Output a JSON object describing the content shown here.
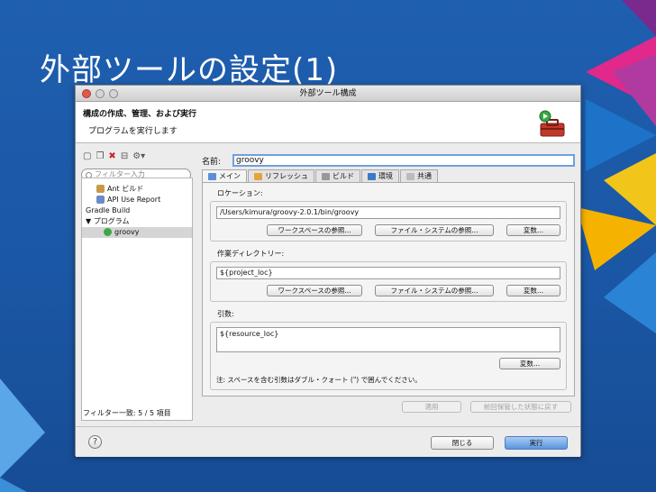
{
  "slide": {
    "title": "外部ツールの設定(1)"
  },
  "window": {
    "title": "外部ツール構成"
  },
  "header": {
    "heading": "構成の作成、管理、および実行",
    "subheading": "プログラムを実行します"
  },
  "sidebar": {
    "filter_placeholder": "フィルター入力",
    "items": [
      {
        "label": "Ant ビルド"
      },
      {
        "label": "API Use Report"
      },
      {
        "label": "Gradle Build"
      },
      {
        "label": "▼ プログラム"
      },
      {
        "label": "groovy"
      }
    ],
    "status": "フィルター一致: 5 / 5 項目"
  },
  "config": {
    "name_label": "名前:",
    "name_value": "groovy",
    "tabs": [
      {
        "label": "メイン"
      },
      {
        "label": "リフレッシュ"
      },
      {
        "label": "ビルド"
      },
      {
        "label": "環境"
      },
      {
        "label": "共通"
      }
    ],
    "location": {
      "label": "ロケーション:",
      "value": "/Users/kimura/groovy-2.0.1/bin/groovy",
      "buttons": [
        "ワークスペースの参照...",
        "ファイル・システムの参照...",
        "変数..."
      ]
    },
    "workdir": {
      "label": "作業ディレクトリー:",
      "value": "${project_loc}",
      "buttons": [
        "ワークスペースの参照...",
        "ファイル・システムの参照...",
        "変数..."
      ]
    },
    "args": {
      "label": "引数:",
      "value": "${resource_loc}",
      "button": "変数...",
      "note": "注: スペースを含む引数はダブル・クォート (\") で囲んでください。"
    },
    "apply_label": "適用",
    "revert_label": "前回保管した状態に戻す"
  },
  "footer": {
    "help": "?",
    "close_label": "閉じる",
    "run_label": "実行"
  }
}
